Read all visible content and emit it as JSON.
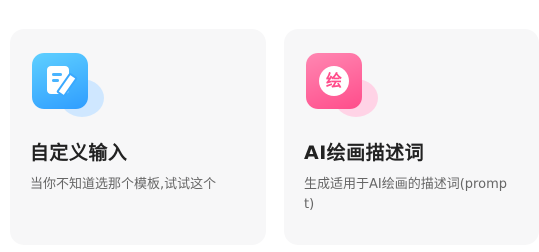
{
  "cards": [
    {
      "icon": "edit-document-icon",
      "icon_color": "#2f9dff",
      "title": "自定义输入",
      "description": "当你不知道选那个模板,试试这个"
    },
    {
      "icon": "painting-badge-icon",
      "icon_color": "#ff4d8b",
      "icon_glyph": "绘",
      "title": "AI绘画描述词",
      "description": "生成适用于AI绘画的描述词(prompt)"
    }
  ]
}
